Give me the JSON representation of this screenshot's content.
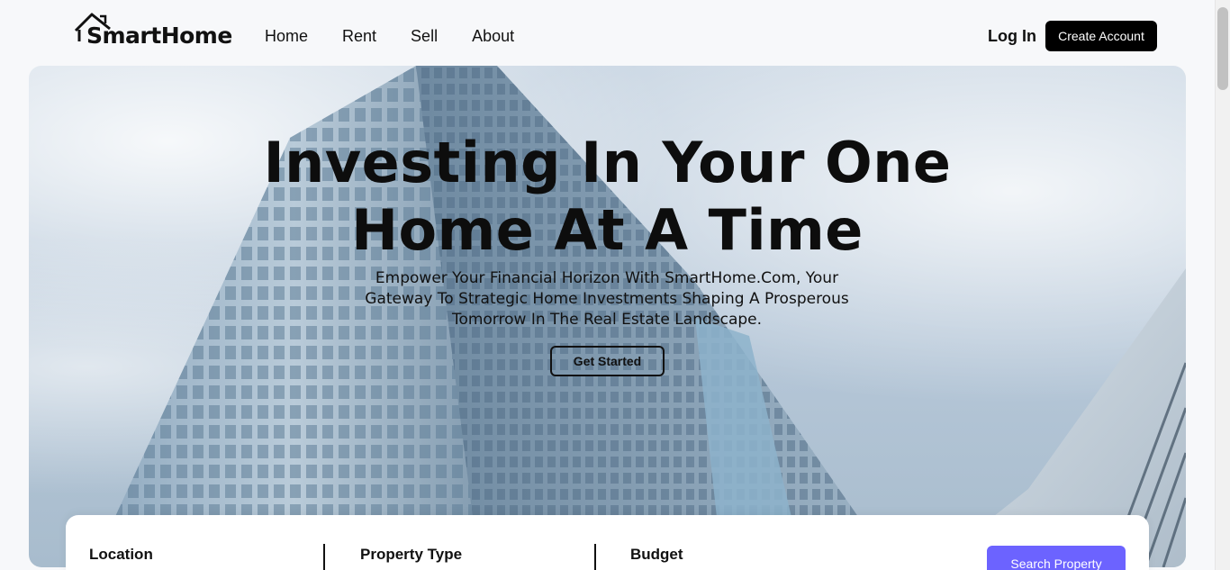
{
  "brand": {
    "name": "SmartHome"
  },
  "nav": {
    "links": [
      {
        "label": "Home"
      },
      {
        "label": "Rent"
      },
      {
        "label": "Sell"
      },
      {
        "label": "About"
      }
    ],
    "login_label": "Log In",
    "create_account_label": "Create Account"
  },
  "hero": {
    "title_line1": "Investing In Your One",
    "title_line2": "Home At A Time",
    "subtitle": "Empower Your Financial Horizon With SmartHome.Com, Your Gateway To Strategic Home Investments Shaping A Prosperous Tomorrow In The Real Estate Landscape.",
    "cta_label": "Get Started"
  },
  "search": {
    "fields": [
      {
        "label": "Location"
      },
      {
        "label": "Property Type"
      },
      {
        "label": "Budget"
      }
    ],
    "button_label": "Search Property",
    "button_color": "#6c63ff"
  },
  "icons": {
    "logo": "house-roof-icon"
  }
}
